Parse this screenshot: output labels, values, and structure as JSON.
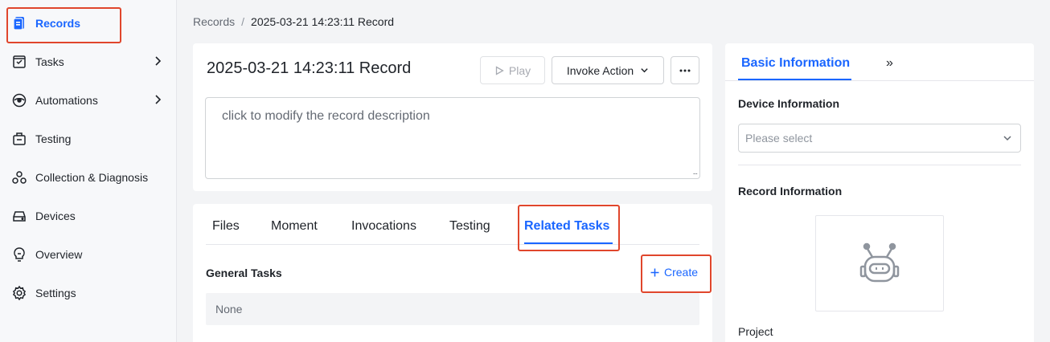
{
  "sidebar": {
    "items": [
      {
        "label": "Records",
        "icon": "records-icon"
      },
      {
        "label": "Tasks",
        "icon": "tasks-icon"
      },
      {
        "label": "Automations",
        "icon": "automations-icon"
      },
      {
        "label": "Testing",
        "icon": "testing-icon"
      },
      {
        "label": "Collection & Diagnosis",
        "icon": "collection-diagnosis-icon"
      },
      {
        "label": "Devices",
        "icon": "devices-icon"
      },
      {
        "label": "Overview",
        "icon": "overview-icon"
      },
      {
        "label": "Settings",
        "icon": "gear-icon"
      }
    ],
    "active_color": "#1a66ff"
  },
  "breadcrumb": {
    "parent": "Records",
    "separator": "/",
    "current": "2025-03-21 14:23:11 Record"
  },
  "record": {
    "title": "2025-03-21 14:23:11 Record",
    "play_label": "Play",
    "invoke_label": "Invoke Action",
    "more_label": "···",
    "description_placeholder": "click to modify the record description"
  },
  "tabs": {
    "items": [
      "Files",
      "Moment",
      "Invocations",
      "Testing",
      "Related Tasks"
    ],
    "active": "Related Tasks"
  },
  "related_tasks": {
    "section_title": "General Tasks",
    "create_label": "Create",
    "empty_text": "None"
  },
  "right_panel": {
    "tab_label": "Basic Information",
    "expand_label": "»",
    "device_info_label": "Device Information",
    "device_select_placeholder": "Please select",
    "record_info_label": "Record Information",
    "project_label": "Project"
  },
  "colors": {
    "accent": "#1a66ff",
    "highlight_box": "#e0462c"
  }
}
